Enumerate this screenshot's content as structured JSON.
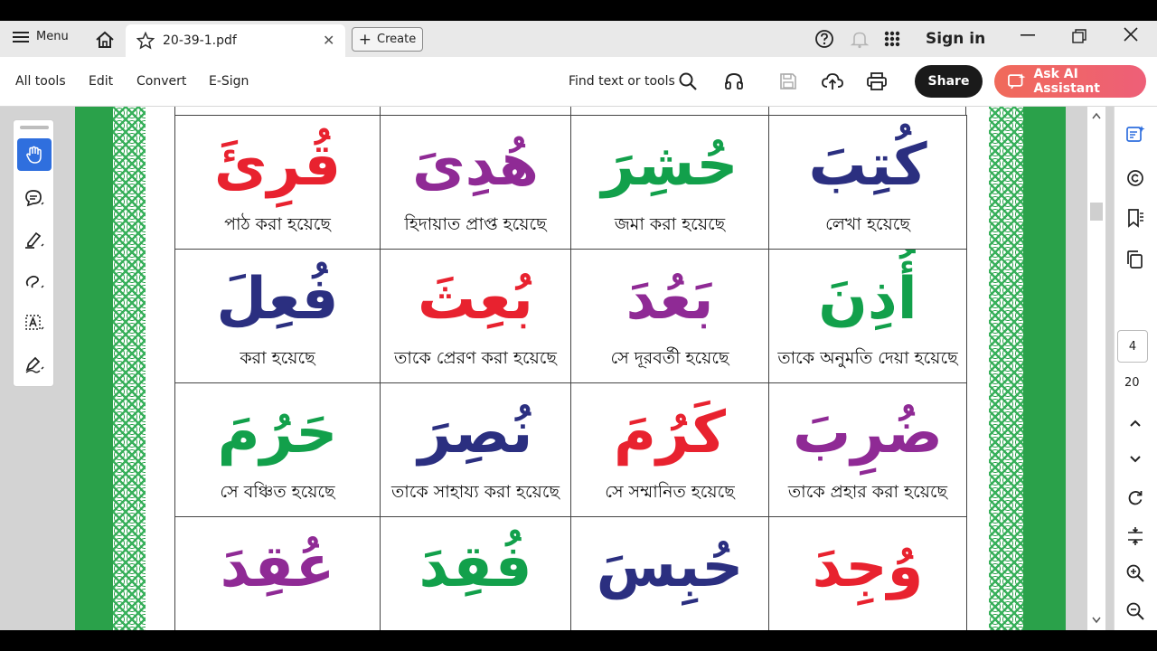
{
  "tabbar": {
    "menu_label": "Menu",
    "doc_name": "20-39-1.pdf",
    "close_glyph": "✕",
    "create_label": "Create",
    "sign_in": "Sign in"
  },
  "toolbar": {
    "all_tools": "All tools",
    "edit": "Edit",
    "convert": "Convert",
    "esign": "E-Sign",
    "find_text": "Find text or tools",
    "share": "Share",
    "ask_ai": "Ask AI Assistant"
  },
  "colors": {
    "red": "#e8222f",
    "purple": "#8f2a95",
    "green": "#12a04b",
    "navy": "#2b2f80",
    "accent_blue": "#2f6fde"
  },
  "grid": {
    "rows": [
      [
        {
          "arabic": "قُرِئَ",
          "bangla": "পাঠ করা হয়েছে",
          "color": "#e8222f"
        },
        {
          "arabic": "هُدِىَ",
          "bangla": "হিদায়াত প্রাপ্ত হয়েছে",
          "color": "#8f2a95"
        },
        {
          "arabic": "حُشِرَ",
          "bangla": "জমা করা হয়েছে",
          "color": "#12a04b"
        },
        {
          "arabic": "كُتِبَ",
          "bangla": "লেখা হয়েছে",
          "color": "#2b2f80"
        }
      ],
      [
        {
          "arabic": "فُعِلَ",
          "bangla": "করা হয়েছে",
          "color": "#2b2f80"
        },
        {
          "arabic": "بُعِثَ",
          "bangla": "তাকে প্রেরণ করা হয়েছে",
          "color": "#e8222f"
        },
        {
          "arabic": "بَعُدَ",
          "bangla": "সে দূরবর্তী হয়েছে",
          "color": "#8f2a95"
        },
        {
          "arabic": "أُذِنَ",
          "bangla": "তাকে অনুমতি দেয়া হয়েছে",
          "color": "#12a04b"
        }
      ],
      [
        {
          "arabic": "حَرُمَ",
          "bangla": "সে বঞ্চিত হয়েছে",
          "color": "#12a04b"
        },
        {
          "arabic": "نُصِرَ",
          "bangla": "তাকে সাহায্য করা হয়েছে",
          "color": "#2b2f80"
        },
        {
          "arabic": "كَرُمَ",
          "bangla": "সে সম্মানিত হয়েছে",
          "color": "#e8222f"
        },
        {
          "arabic": "ضُرِبَ",
          "bangla": "তাকে প্রহার করা হয়েছে",
          "color": "#8f2a95"
        }
      ],
      [
        {
          "arabic": "عُقِدَ",
          "bangla": "",
          "color": "#8f2a95"
        },
        {
          "arabic": "فُقِدَ",
          "bangla": "",
          "color": "#12a04b"
        },
        {
          "arabic": "حُبِسَ",
          "bangla": "",
          "color": "#2b2f80"
        },
        {
          "arabic": "وُجِدَ",
          "bangla": "",
          "color": "#e8222f"
        }
      ]
    ]
  },
  "pagination": {
    "current": "4",
    "total": "20"
  }
}
